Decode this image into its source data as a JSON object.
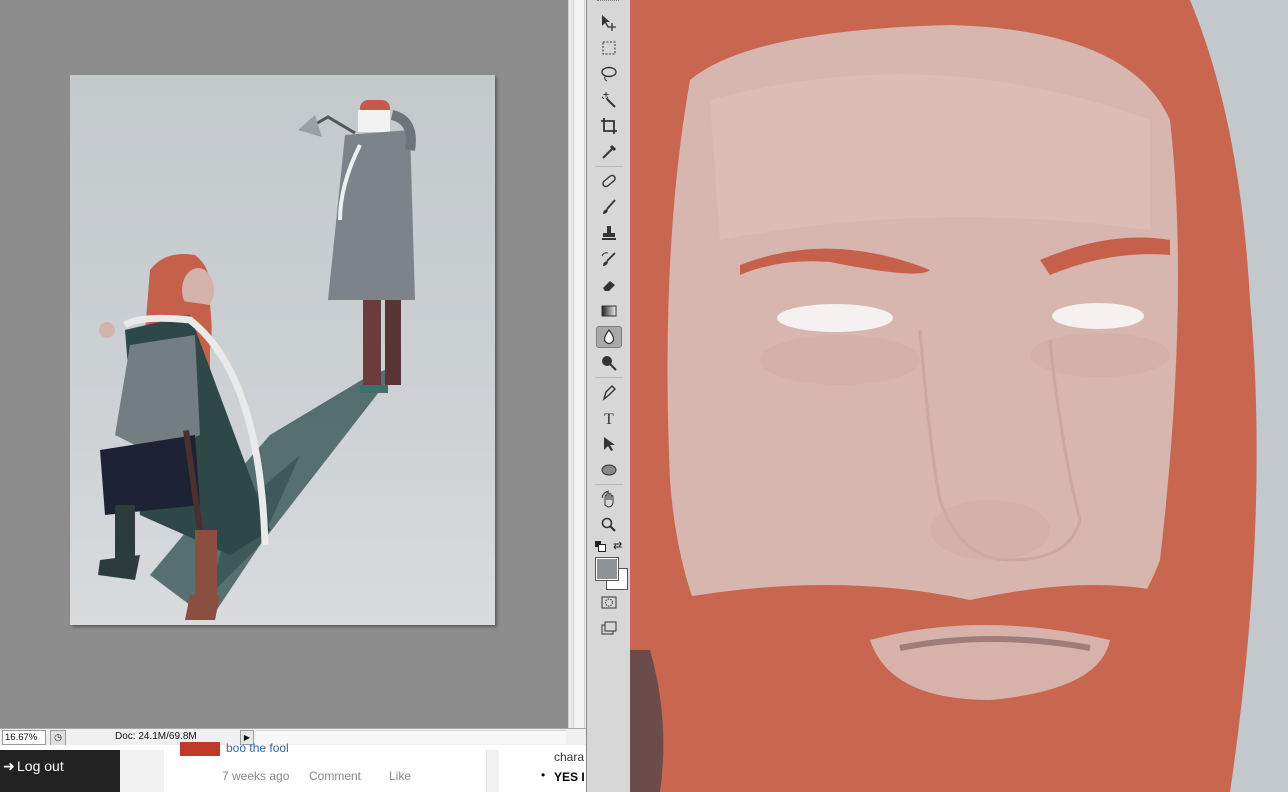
{
  "status_bar": {
    "zoom": "16.67%",
    "doc_size": "Doc: 24.1M/69.8M"
  },
  "tools": [
    {
      "name": "move-tool-icon",
      "glyph": "▸✥"
    },
    {
      "name": "marquee-tool-icon",
      "glyph": "⬚"
    },
    {
      "name": "lasso-tool-icon",
      "glyph": "ʘ"
    },
    {
      "name": "magic-wand-tool-icon",
      "glyph": "✲"
    },
    {
      "name": "crop-tool-icon",
      "glyph": "⌗"
    },
    {
      "name": "eyedropper-tool-icon",
      "glyph": "⁄"
    },
    {
      "name": "healing-brush-tool-icon",
      "glyph": "✚"
    },
    {
      "name": "brush-tool-icon",
      "glyph": "⁄"
    },
    {
      "name": "clone-stamp-tool-icon",
      "glyph": "⊥"
    },
    {
      "name": "history-brush-tool-icon",
      "glyph": "⁄"
    },
    {
      "name": "eraser-tool-icon",
      "glyph": "▱"
    },
    {
      "name": "gradient-tool-icon",
      "glyph": "▭"
    },
    {
      "name": "blur-tool-icon",
      "glyph": "💧"
    },
    {
      "name": "dodge-tool-icon",
      "glyph": "●"
    },
    {
      "name": "pen-tool-icon",
      "glyph": "✒"
    },
    {
      "name": "type-tool-icon",
      "glyph": "T"
    },
    {
      "name": "path-selection-tool-icon",
      "glyph": "➤"
    },
    {
      "name": "ellipse-tool-icon",
      "glyph": "⬭"
    },
    {
      "name": "rotate-view-tool-icon",
      "glyph": "✋"
    },
    {
      "name": "zoom-tool-icon",
      "glyph": "🔍"
    }
  ],
  "colors": {
    "foreground": "#8d9297",
    "background": "#ffffff",
    "workspace": "#8d8d8d",
    "hair": "#c8664f",
    "skin": "#d9b6ae"
  },
  "web": {
    "logout_label": "Log out",
    "commenter": "boo the fool",
    "time_ago": "7 weeks ago",
    "comment_label": "Comment",
    "like_label": "Like",
    "snippet_top": "chara",
    "snippet_bold": "YES I"
  }
}
